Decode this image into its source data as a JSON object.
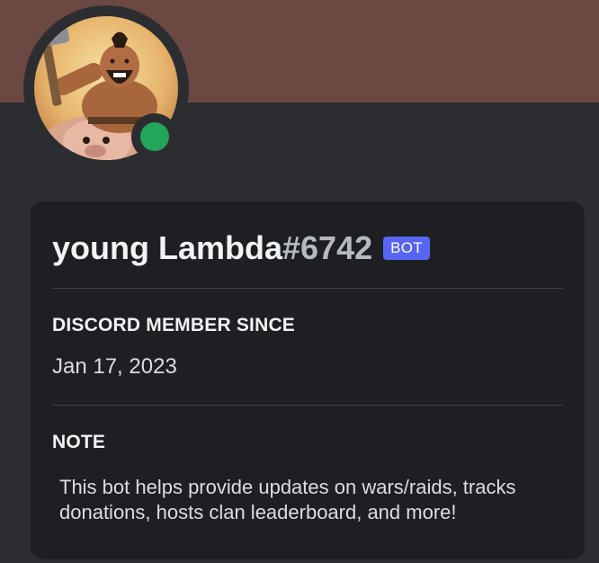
{
  "profile": {
    "username": "young Lambda",
    "discriminator": "#6742",
    "bot_tag": "BOT",
    "status": "online",
    "avatar_subject": "Hog Rider character avatar"
  },
  "sections": {
    "member_since_title": "DISCORD MEMBER SINCE",
    "member_since_date": "Jan 17, 2023",
    "note_title": "NOTE",
    "note_text": "This bot helps provide updates on wars/raids, tracks donations, hosts clan leaderboard, and more!"
  },
  "colors": {
    "banner": "#6b4842",
    "background": "#2b2d31",
    "card": "#1e1f22",
    "bot_tag": "#5865f2",
    "status_online": "#23a55a"
  }
}
